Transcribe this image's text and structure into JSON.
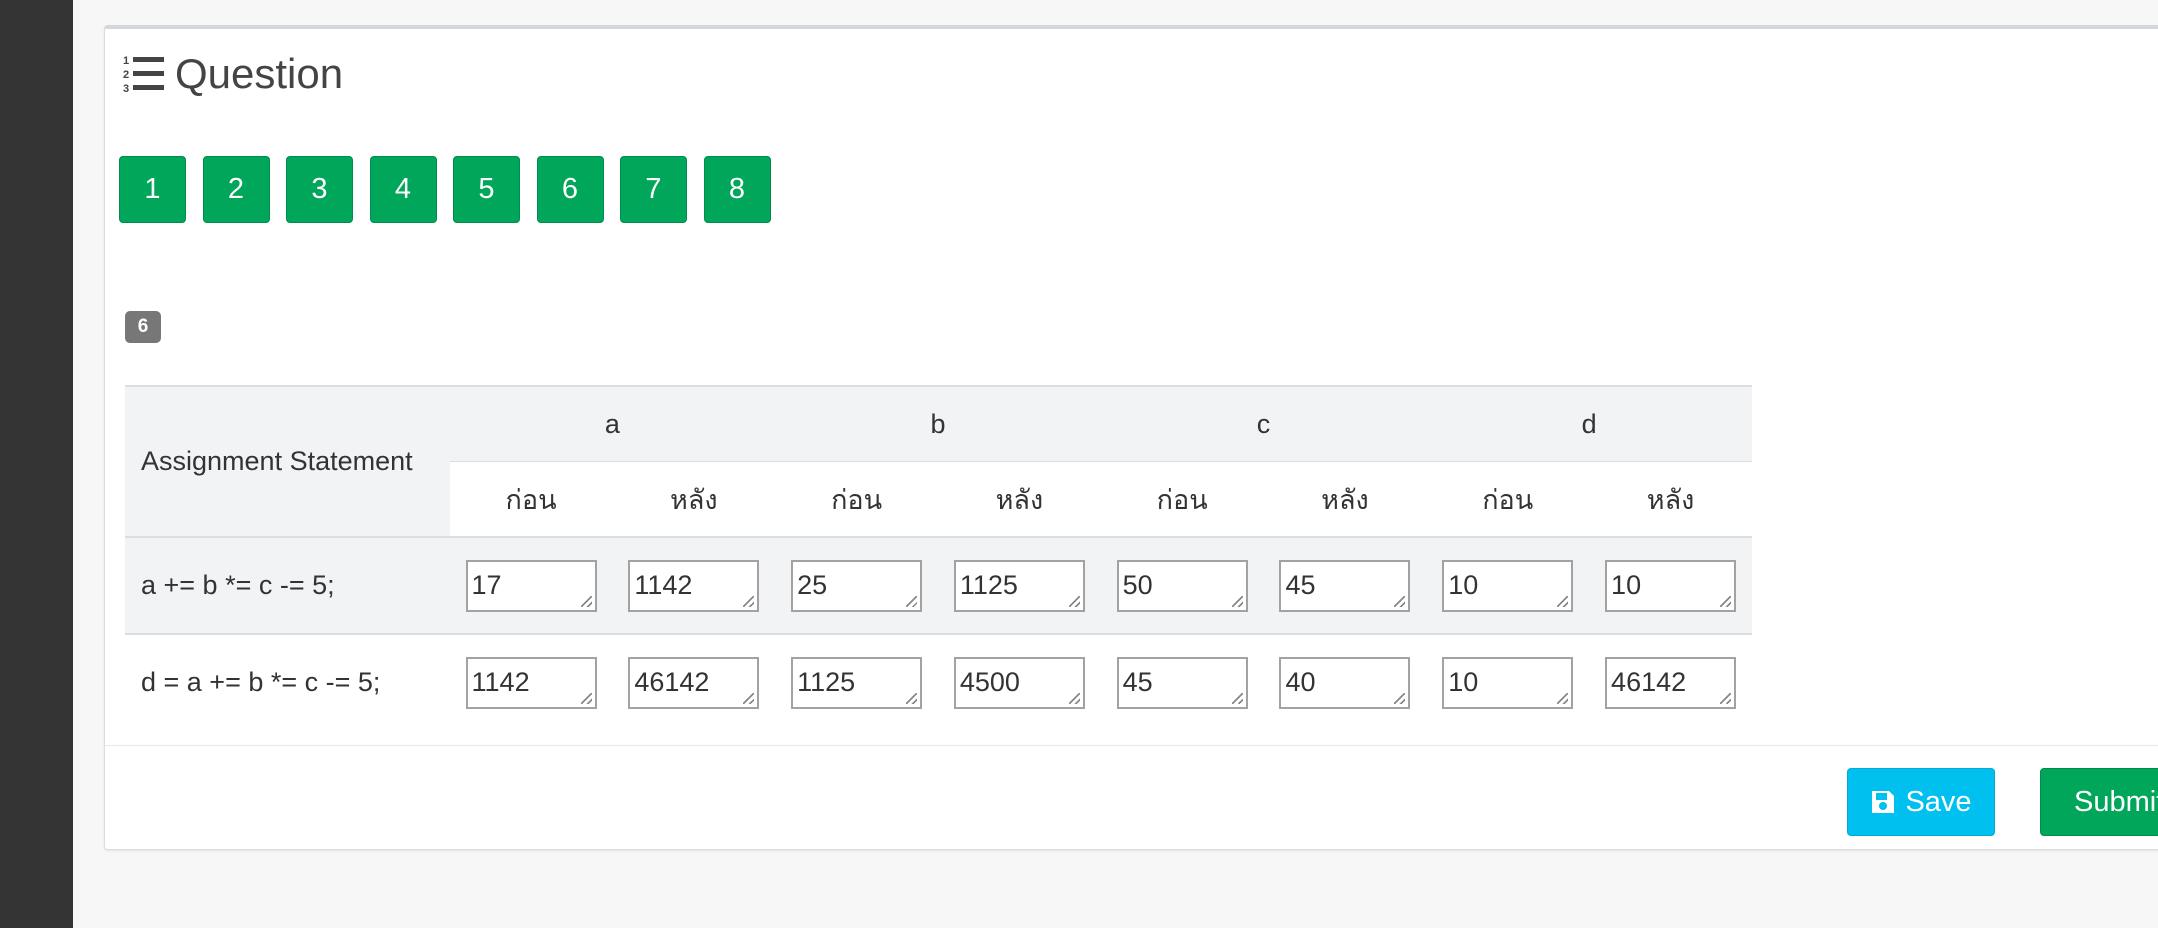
{
  "panel": {
    "title": "Question"
  },
  "question_nav": [
    "1",
    "2",
    "3",
    "4",
    "5",
    "6",
    "7",
    "8"
  ],
  "current_question_badge": "6",
  "table": {
    "statement_header": "Assignment Statement",
    "variables": [
      "a",
      "b",
      "c",
      "d"
    ],
    "before_label": "ก่อน",
    "after_label": "หลัง",
    "rows": [
      {
        "statement": "a += b *= c -= 5;",
        "values": [
          "17",
          "1142",
          "25",
          "1125",
          "50",
          "45",
          "10",
          "10"
        ]
      },
      {
        "statement": "d = a += b *= c -= 5;",
        "values": [
          "1142",
          "46142",
          "1125",
          "4500",
          "45",
          "40",
          "10",
          "46142"
        ]
      }
    ]
  },
  "footer": {
    "save_label": "Save",
    "submit_label": "Submit"
  },
  "colors": {
    "green": "#00a65a",
    "cyan": "#00c0ef",
    "badge_gray": "#777777",
    "sidebar": "#333333"
  },
  "icons": {
    "title": "list-ol-icon",
    "save": "floppy-disk-icon"
  }
}
